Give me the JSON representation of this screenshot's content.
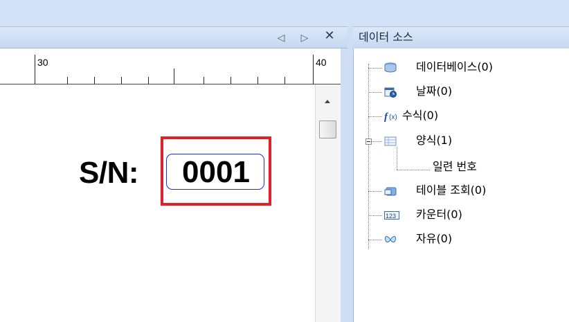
{
  "editor": {
    "tab_controls": {
      "left_arrow": "◁",
      "right_arrow": "▷",
      "close": "✕"
    },
    "ruler": {
      "labels": [
        "30",
        "40"
      ]
    },
    "field": {
      "prefix": "S/N:",
      "value": "0001"
    }
  },
  "data_source": {
    "title": "데이터 소스",
    "items": [
      {
        "label": "데이터베이스(0)",
        "icon": "database-icon"
      },
      {
        "label": "날짜(0)",
        "icon": "calendar-icon"
      },
      {
        "label": "수식(0)",
        "icon": "formula-icon"
      },
      {
        "label": "양식(1)",
        "icon": "form-icon",
        "children": [
          {
            "label": "일련 번호"
          }
        ]
      },
      {
        "label": "테이블 조회(0)",
        "icon": "table-lookup-icon"
      },
      {
        "label": "카운터(0)",
        "icon": "counter-icon"
      },
      {
        "label": "자유(0)",
        "icon": "free-icon"
      }
    ]
  },
  "colors": {
    "selection_border": "#e0202a",
    "field_border": "#1b2ee0",
    "panel_header": "#c6d8f1"
  }
}
